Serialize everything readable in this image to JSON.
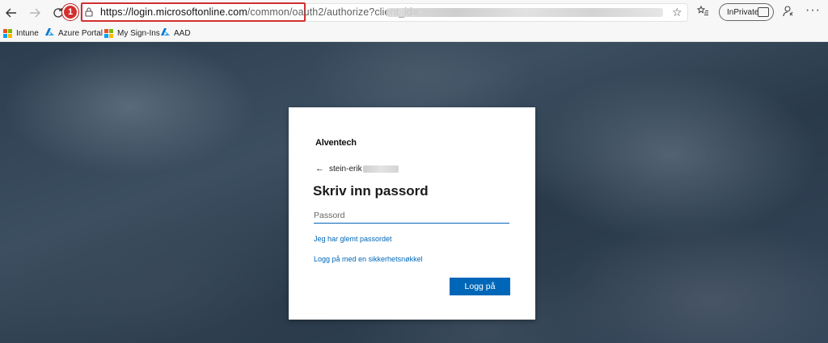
{
  "browser": {
    "url_host": "https://login.microsoftonline.com",
    "url_path": "/common/oauth2",
    "url_rest": "/authorize?client_id=",
    "step_badge": "1",
    "inprivate_label": "InPrivate"
  },
  "favorites": [
    {
      "label": "Intune"
    },
    {
      "label": "Azure Portal"
    },
    {
      "label": "My Sign-Ins"
    },
    {
      "label": "AAD"
    }
  ],
  "login": {
    "brand": "Alventech",
    "username": "stein-erik",
    "heading": "Skriv inn passord",
    "password_placeholder": "Passord",
    "forgot_link": "Jeg har glemt passordet",
    "security_key_link": "Logg på med en sikkerhetsnøkkel",
    "signin_button": "Logg på"
  },
  "colors": {
    "accent": "#0067b8",
    "highlight": "#d32f2f"
  }
}
